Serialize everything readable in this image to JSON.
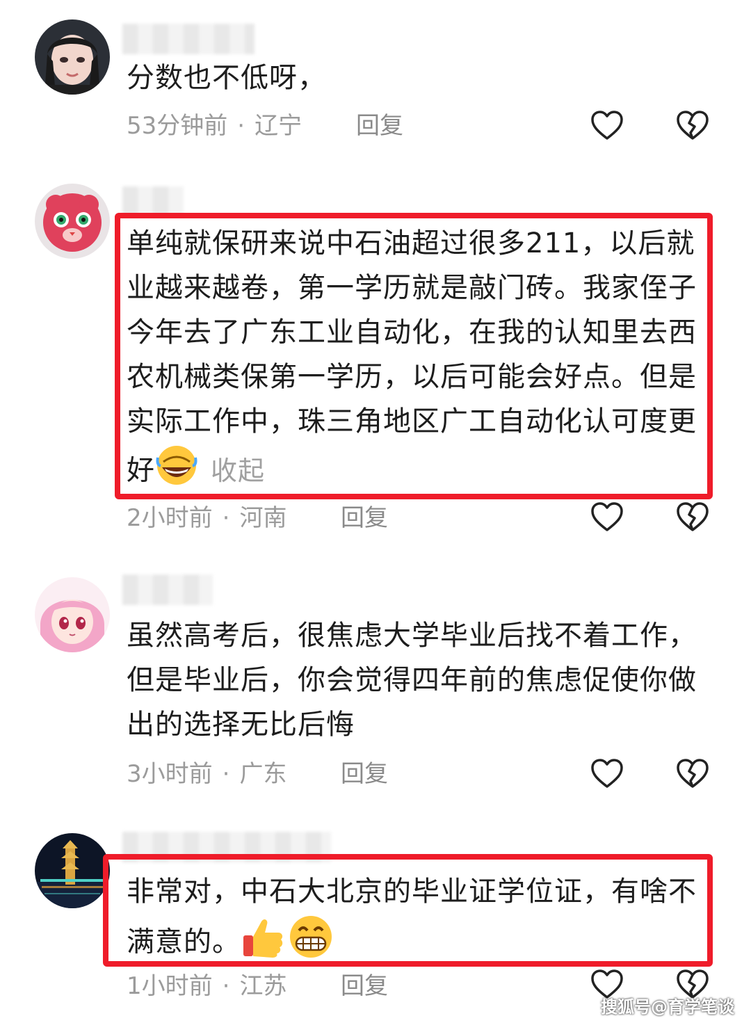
{
  "comments": [
    {
      "text": "分数也不低呀，",
      "time": "53分钟前",
      "location": "辽宁",
      "reply_label": "回复"
    },
    {
      "text": "单纯就保研来说中石油超过很多211，以后就业越来越卷，第一学历就是敲门砖。我家侄子今年去了广东工业自动化，在我的认知里去西农机械类保第一学历，以后可能会好点。但是实际工作中，珠三角地区广工自动化认可度更好",
      "collapse_label": "收起",
      "time": "2小时前",
      "location": "河南",
      "reply_label": "回复"
    },
    {
      "text": "虽然高考后，很焦虑大学毕业后找不着工作，但是毕业后，你会觉得四年前的焦虑促使你做出的选择无比后悔",
      "time": "3小时前",
      "location": "广东",
      "reply_label": "回复"
    },
    {
      "text": "非常对，中石大北京的毕业证学位证，有啥不满意的。",
      "time": "1小时前",
      "location": "江苏",
      "reply_label": "回复"
    }
  ],
  "separator": "·",
  "icons": {
    "like": "heart-outline-icon",
    "dislike": "broken-heart-icon",
    "emoji_facepalm": "rolling-laughing-emoji",
    "emoji_thumbs": "thumbs-up-emoji",
    "emoji_grin": "grinning-emoji"
  },
  "colors": {
    "highlight": "#ef1c2a",
    "meta_text": "#9b9b9b",
    "body_text": "#1d1d1d"
  },
  "watermark": "搜狐号@育学笔谈"
}
